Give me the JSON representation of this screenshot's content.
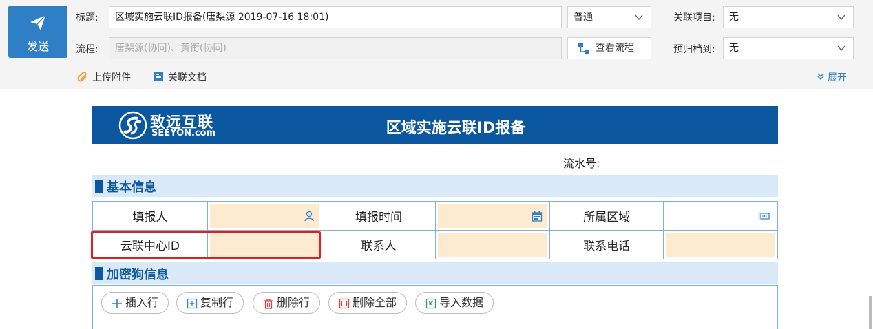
{
  "toolbar": {
    "send_label": "发送",
    "title_label": "标题:",
    "title_value": "区域实施云联ID报备(唐梨源 2019-07-16 18:01)",
    "priority_value": "普通",
    "project_label": "关联项目:",
    "project_value": "无",
    "flow_label": "流程:",
    "flow_value": "唐梨源(协同)、黄衔(协同)",
    "view_flow_label": "查看流程",
    "archive_label": "预归档到:",
    "archive_value": "无",
    "upload_label": "上传附件",
    "related_doc_label": "关联文档",
    "expand_label": "展开"
  },
  "form": {
    "logo_cn": "致远互联",
    "logo_en": "SEEYON.com",
    "title": "区域实施云联ID报备",
    "serial_label": "流水号:",
    "section_basic": "基本信息",
    "section_dongle": "加密狗信息",
    "fields": {
      "reporter": "填报人",
      "report_time": "填报时间",
      "region": "所属区域",
      "cloud_center_id": "云联中心ID",
      "contact": "联系人",
      "phone": "联系电话"
    },
    "actions": {
      "insert_row": "插入行",
      "copy_row": "复制行",
      "delete_row": "删除行",
      "delete_all": "删除全部",
      "import_data": "导入数据"
    }
  },
  "colors": {
    "accent": "#2f7fc6",
    "banner": "#0b57a0",
    "section_bg": "#d9e9f7",
    "input_fill": "#fdebcf",
    "highlight": "#e02020"
  }
}
